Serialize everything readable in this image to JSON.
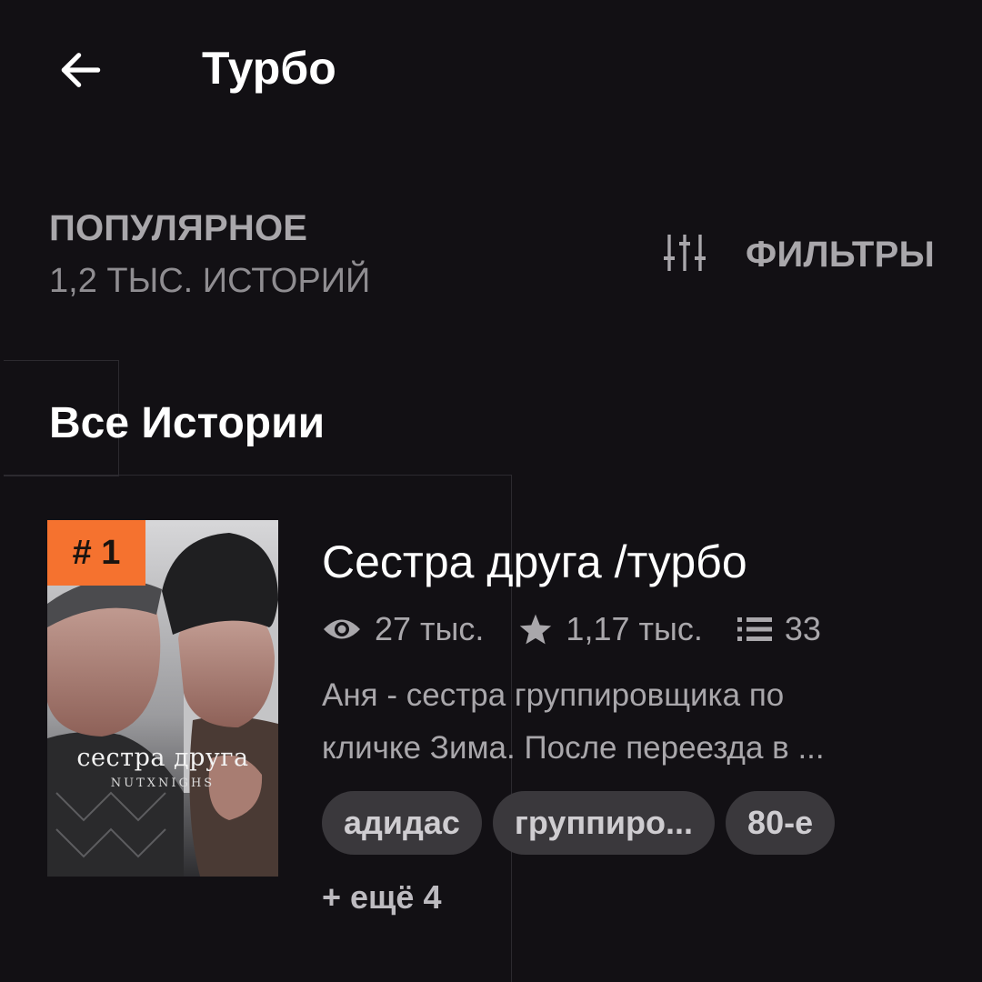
{
  "header": {
    "title": "Турбо"
  },
  "sort": {
    "label": "ПОПУЛЯРНОЕ",
    "count": "1,2 ТЫС. ИСТОРИЙ"
  },
  "filter": {
    "label": "ФИЛЬТРЫ"
  },
  "section": {
    "title": "Все Истории"
  },
  "story": {
    "rank": "# 1",
    "title": "Сестра друга /турбо",
    "cover_caption": "сестра друга",
    "cover_subcaption": "NUTXNIGHS",
    "stats": {
      "reads": "27 тыс.",
      "votes": "1,17 тыс.",
      "parts": "33"
    },
    "description_lines": [
      "Аня - сестра группировщика по",
      "кличке Зима. После переезда в ..."
    ],
    "tags": [
      "адидас",
      "группиро...",
      "80-е"
    ],
    "more_tags": "+ ещё 4"
  },
  "colors": {
    "background": "#121014",
    "accent": "#f5722f",
    "muted_text": "#a9a7ab",
    "tag_background": "#3a383c"
  },
  "icons": {
    "back": "arrow-left-icon",
    "filter": "sliders-icon",
    "reads": "eye-icon",
    "votes": "star-icon",
    "parts": "list-icon"
  }
}
